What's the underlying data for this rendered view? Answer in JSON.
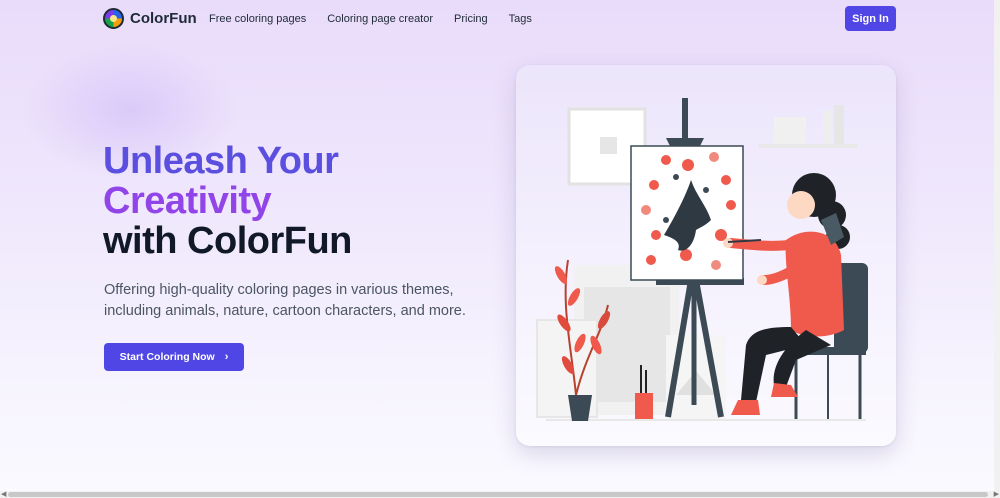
{
  "brand": {
    "name": "ColorFun",
    "logo_icon": "palette-logo-icon"
  },
  "nav": {
    "links": [
      {
        "label": "Free coloring pages"
      },
      {
        "label": "Coloring page creator"
      },
      {
        "label": "Pricing"
      },
      {
        "label": "Tags"
      }
    ],
    "signin_label": "Sign In"
  },
  "hero": {
    "headline_line1": "Unleash Your",
    "headline_line2": "Creativity",
    "headline_line3": "with ColorFun",
    "subtitle": "Offering high-quality coloring pages in various themes, including animals, nature, cartoon characters, and more.",
    "cta_label": "Start Coloring Now",
    "cta_icon": "chevron-right-icon"
  },
  "illustration": {
    "subject": "artist-painting-at-easel-illustration"
  },
  "colors": {
    "primary": "#4f46e5",
    "headline_blue": "#5b4fe0",
    "headline_purple": "#9145e8",
    "accent_coral": "#ef5a4c"
  }
}
